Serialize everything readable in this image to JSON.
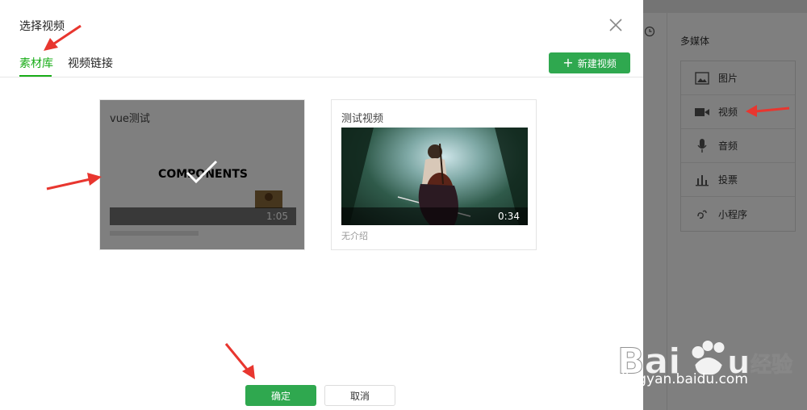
{
  "dialog": {
    "title": "选择视频",
    "tabs": [
      {
        "label": "素材库",
        "active": true
      },
      {
        "label": "视频链接",
        "active": false
      }
    ],
    "new_video_label": "新建视频",
    "ok_label": "确定",
    "cancel_label": "取消"
  },
  "videos": [
    {
      "title": "vue测试",
      "thumb_text": "COMPONENTS",
      "duration": "1:05",
      "selected": true
    },
    {
      "title": "测试视频",
      "duration": "0:34",
      "description": "无介绍",
      "selected": false
    }
  ],
  "sidebar": {
    "title": "多媒体",
    "items": [
      {
        "label": "图片",
        "icon": "image-icon"
      },
      {
        "label": "视频",
        "icon": "video-camera-icon"
      },
      {
        "label": "音频",
        "icon": "microphone-icon"
      },
      {
        "label": "投票",
        "icon": "bar-chart-icon"
      },
      {
        "label": "小程序",
        "icon": "mini-program-icon"
      }
    ]
  },
  "watermark": {
    "text": "jingyan.baidu.com"
  },
  "colors": {
    "accent": "#1aad19",
    "button_green": "#2fa84f",
    "annotation_red": "#e8362f"
  }
}
